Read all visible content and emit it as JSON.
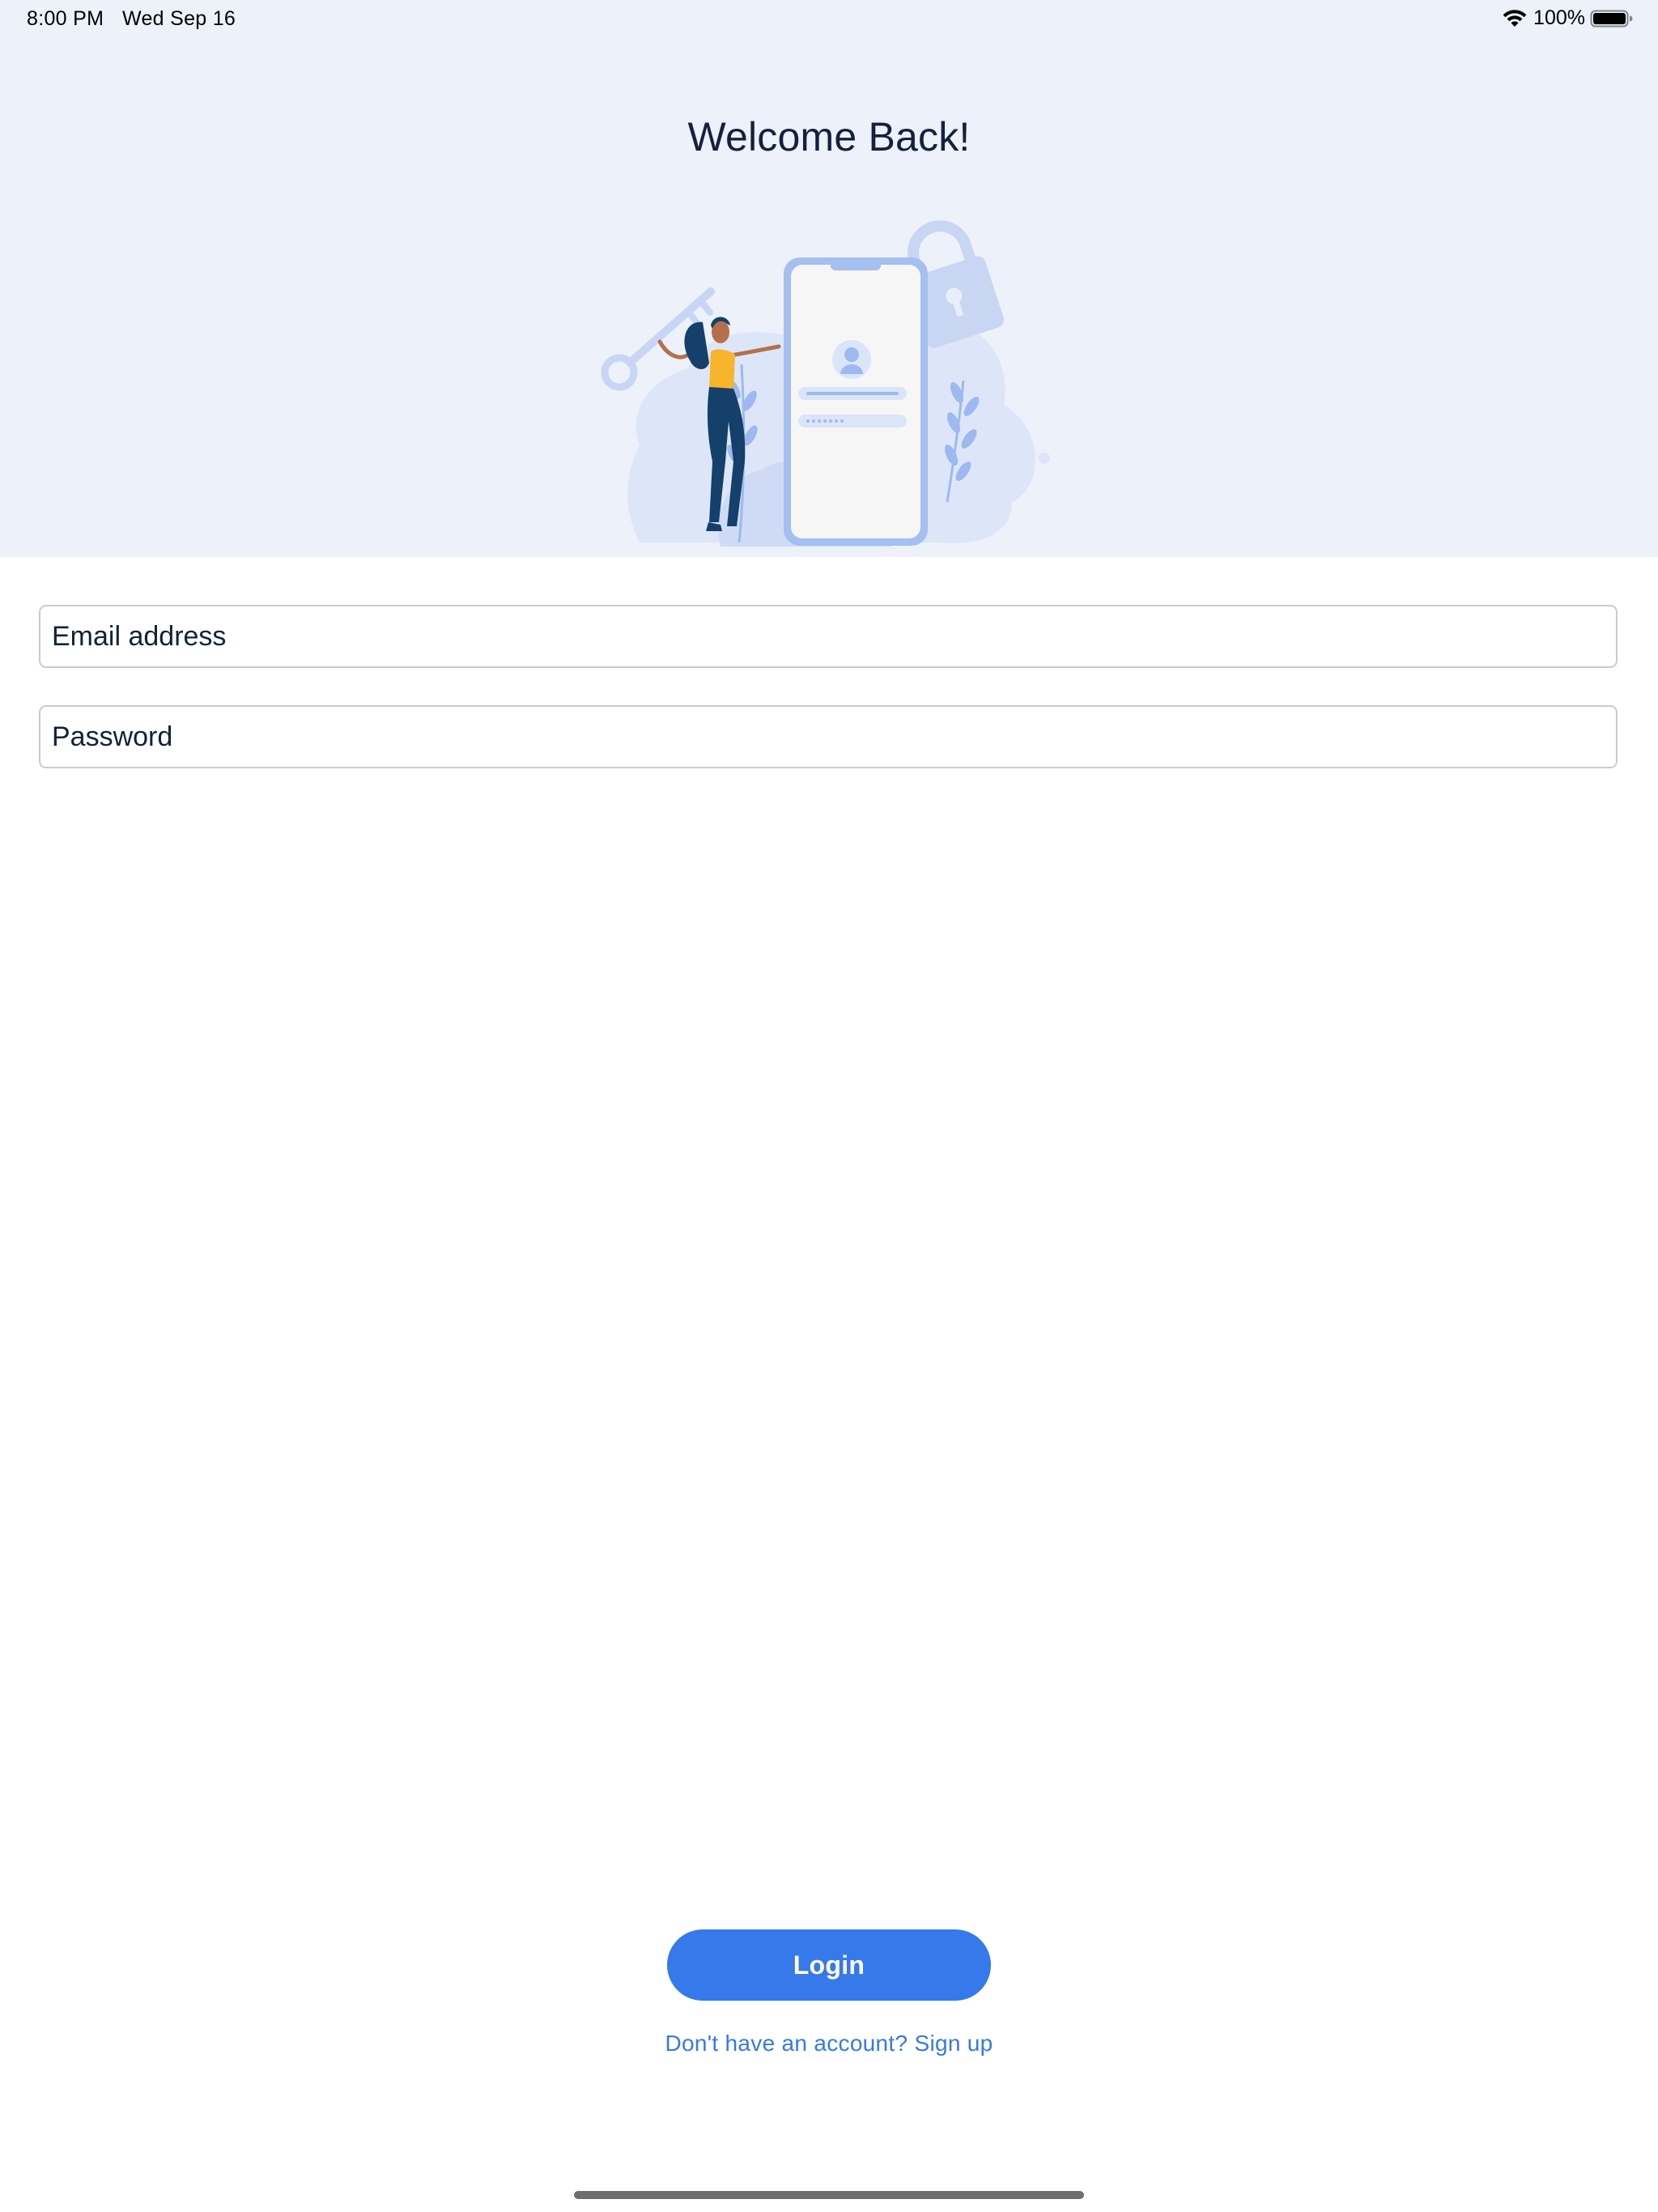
{
  "status_bar": {
    "time": "8:00 PM",
    "date": "Wed Sep 16",
    "battery_percent": "100%",
    "wifi_icon": "wifi-icon",
    "battery_icon": "battery-icon",
    "battery_level": 1.0
  },
  "header": {
    "title": "Welcome Back!",
    "illustration": "login-illustration"
  },
  "form": {
    "email": {
      "placeholder": "Email address",
      "value": ""
    },
    "password": {
      "placeholder": "Password",
      "value": ""
    }
  },
  "actions": {
    "login_label": "Login",
    "signup_label": "Don't have an account? Sign up"
  },
  "colors": {
    "hero_background": "#ecf1fa",
    "accent": "#3579ea",
    "title_text": "#14213d",
    "illustration_blue": "#a4bff0",
    "figure_shirt": "#f7b52c",
    "figure_pants": "#14406b"
  }
}
